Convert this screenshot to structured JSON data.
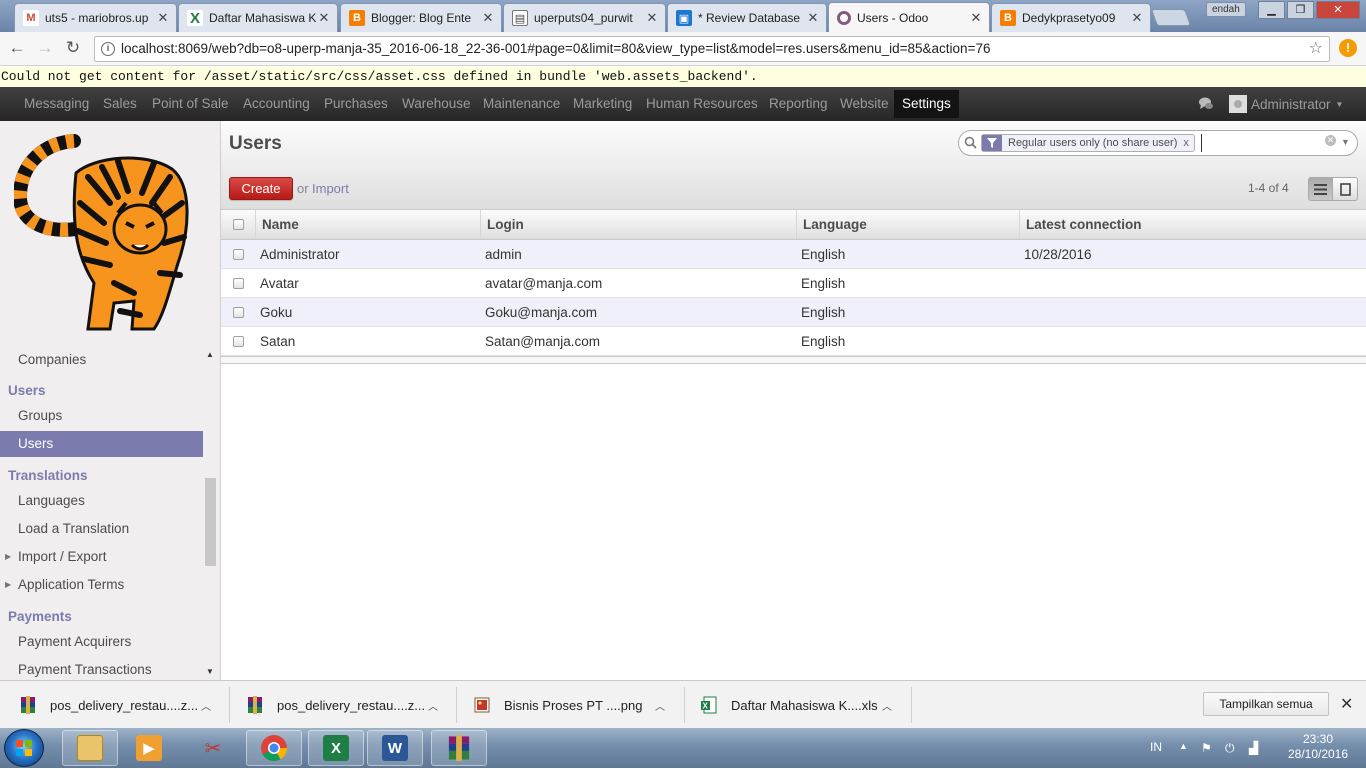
{
  "browser": {
    "tabs": [
      {
        "label": "uts5 - mariobros.up",
        "icon": "gmail-icon",
        "color": "#d44638",
        "glyph": "M"
      },
      {
        "label": "Daftar Mahasiswa K",
        "icon": "sheets-x-icon",
        "color": "#1e7e45",
        "glyph": "X"
      },
      {
        "label": "Blogger: Blog Ente",
        "icon": "blogger-icon",
        "color": "#f57d00",
        "glyph": "B"
      },
      {
        "label": "uperputs04_purwit",
        "icon": "book-icon",
        "color": "#666666",
        "glyph": "▤"
      },
      {
        "label": "* Review Database",
        "icon": "trello-icon",
        "color": "#1d76d1",
        "glyph": "▣"
      },
      {
        "label": "Users - Odoo",
        "icon": "odoo-icon",
        "color": "#875a7b",
        "glyph": "◯"
      },
      {
        "label": "Dedykprasetyo09",
        "icon": "blogger-icon",
        "color": "#f57d00",
        "glyph": "B"
      }
    ],
    "user_chip": "endah",
    "url": "localhost:8069/web?db=o8-uperp-manja-35_2016-06-18_22-36-001#page=0&limit=80&view_type=list&model=res.users&menu_id=85&action=76",
    "error": "Could not get content for /asset/static/src/css/asset.css defined in bundle 'web.assets_backend'."
  },
  "topmenu": {
    "items": [
      "Messaging",
      "Sales",
      "Point of Sale",
      "Accounting",
      "Purchases",
      "Warehouse",
      "Maintenance",
      "Marketing",
      "Human Resources",
      "Reporting",
      "Website",
      "Settings"
    ],
    "active": "Settings",
    "user": "Administrator"
  },
  "sidebar": {
    "companies": "Companies",
    "users_head": "Users",
    "groups": "Groups",
    "users": "Users",
    "translations_head": "Translations",
    "languages": "Languages",
    "load_translation": "Load a Translation",
    "import_export": "Import / Export",
    "app_terms": "Application Terms",
    "payments_head": "Payments",
    "payment_acquirers": "Payment Acquirers",
    "payment_transactions": "Payment Transactions"
  },
  "main": {
    "title": "Users",
    "facet": "Regular users only (no share user)",
    "facet_close": "x",
    "create": "Create",
    "or": "or",
    "import": "Import",
    "pager": "1-4 of 4",
    "columns": [
      "Name",
      "Login",
      "Language",
      "Latest connection"
    ],
    "rows": [
      {
        "name": "Administrator",
        "login": "admin",
        "language": "English",
        "latest": "10/28/2016"
      },
      {
        "name": "Avatar",
        "login": "avatar@manja.com",
        "language": "English",
        "latest": ""
      },
      {
        "name": "Goku",
        "login": "Goku@manja.com",
        "language": "English",
        "latest": ""
      },
      {
        "name": "Satan",
        "login": "Satan@manja.com",
        "language": "English",
        "latest": ""
      }
    ]
  },
  "downloads": {
    "items": [
      "pos_delivery_restau....z...",
      "pos_delivery_restau....z...",
      "Bisnis Proses PT ....png",
      "Daftar Mahasiswa K....xls"
    ],
    "show_all": "Tampilkan semua"
  },
  "taskbar": {
    "lang": "IN",
    "time": "23:30",
    "date": "28/10/2016"
  }
}
